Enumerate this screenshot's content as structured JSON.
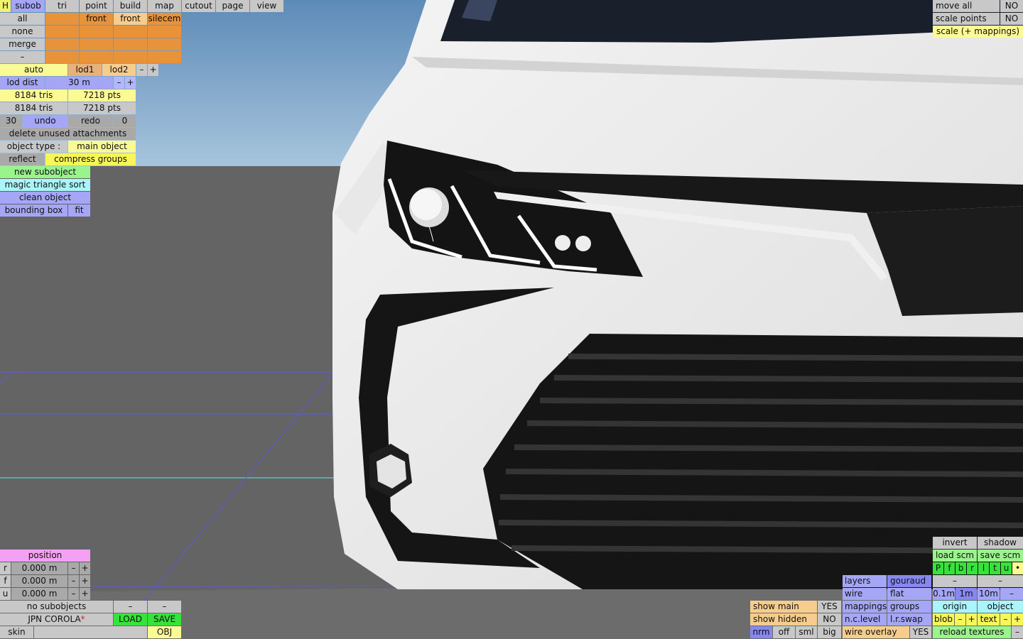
{
  "topbar": {
    "h": "H",
    "tabs": [
      "subob",
      "tri",
      "point",
      "build",
      "map",
      "cutout",
      "page",
      "view"
    ]
  },
  "select": {
    "all": "all",
    "none": "none",
    "merge": "merge",
    "dash": "–"
  },
  "columns": {
    "front1": "front",
    "front2": "front",
    "silecem": "silecem"
  },
  "lod": {
    "auto": "auto",
    "lod1": "lod1",
    "lod2": "lod2",
    "minus": "–",
    "plus": "+",
    "lod_dist_label": "lod dist",
    "lod_dist_value": "30 m"
  },
  "stats": {
    "tris1": "8184 tris",
    "pts1": "7218 pts",
    "tris2": "8184 tris",
    "pts2": "7218 pts"
  },
  "history": {
    "count": "30",
    "undo": "undo",
    "redo": "redo",
    "redo_count": "0"
  },
  "actions": {
    "delete_unused": "delete unused attachments",
    "object_type_label": "object type :",
    "object_type_value": "main object",
    "reflect": "reflect",
    "compress_groups": "compress groups",
    "new_subobject": "new subobject",
    "magic_sort": "magic triangle sort",
    "clean_object": "clean object",
    "bounding_box": "bounding box",
    "fit": "fit"
  },
  "position": {
    "title": "position",
    "rows": [
      {
        "axis": "r",
        "value": "0.000 m"
      },
      {
        "axis": "f",
        "value": "0.000 m"
      },
      {
        "axis": "u",
        "value": "0.000 m"
      }
    ],
    "minus": "–",
    "plus": "+"
  },
  "bottom_left": {
    "no_subobjects": "no subobjects",
    "dash": "–",
    "file_name": "JPN COROLA",
    "asterisk": "*",
    "load": "LOAD",
    "save": "SAVE",
    "skin": "skin",
    "obj": "OBJ"
  },
  "top_right": {
    "move_all": "move all",
    "move_all_val": "NO",
    "scale_points": "scale points",
    "scale_points_val": "NO",
    "scale_mappings": "scale (+ mappings)"
  },
  "bottom_right": {
    "invert": "invert",
    "shadow": "shadow",
    "load_scm": "load scm",
    "save_scm": "save scm",
    "letters": [
      "P",
      "f",
      "b",
      "r",
      "l",
      "t",
      "u",
      "•"
    ],
    "dash": "–",
    "layers": "layers",
    "gouraud": "gouraud",
    "wire": "wire",
    "flat": "flat",
    "grid_01": "0.1m",
    "grid_1": "1m",
    "grid_10": "10m",
    "show_main": "show main",
    "show_main_val": "YES",
    "mappings": "mappings",
    "groups": "groups",
    "origin": "origin",
    "object": "object",
    "show_hidden": "show hidden",
    "show_hidden_val": "NO",
    "nc_level": "n.c.level",
    "lr_swap": "l.r.swap",
    "blob": "blob",
    "minus": "–",
    "plus": "+",
    "text": "text",
    "nrm": "nrm",
    "off": "off",
    "sml": "sml",
    "big": "big",
    "wire_overlay": "wire overlay",
    "wire_overlay_val": "YES",
    "reload_textures": "reload textures"
  }
}
